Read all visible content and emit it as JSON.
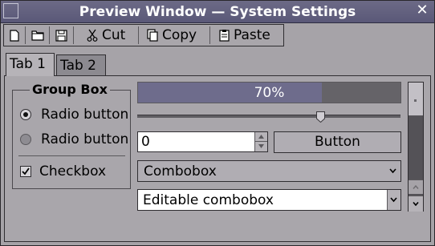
{
  "window": {
    "title": "Preview Window — System Settings",
    "close_label": "✕"
  },
  "toolbar": {
    "cut_label": "Cut",
    "copy_label": "Copy",
    "paste_label": "Paste"
  },
  "tabs": [
    {
      "label": "Tab 1",
      "active": true
    },
    {
      "label": "Tab 2",
      "active": false
    }
  ],
  "group_box": {
    "title": "Group Box",
    "radio_1_label": "Radio button",
    "radio_1_selected": true,
    "radio_2_label": "Radio button",
    "radio_2_selected": false,
    "checkbox_label": "Checkbox",
    "checkbox_checked": true
  },
  "progress": {
    "value": 0.7,
    "text": "70%"
  },
  "slider": {
    "value": 0.7
  },
  "spinbox": {
    "value": "0"
  },
  "button": {
    "label": "Button"
  },
  "combobox": {
    "selected": "Combobox"
  },
  "editable_combobox": {
    "value": "Editable combobox"
  },
  "scrollbar": {
    "position": 0.0
  },
  "colors": {
    "titlebar": "#5a5878",
    "window_bg": "#a6a3a8",
    "progress_fill": "#6e6c8c"
  }
}
